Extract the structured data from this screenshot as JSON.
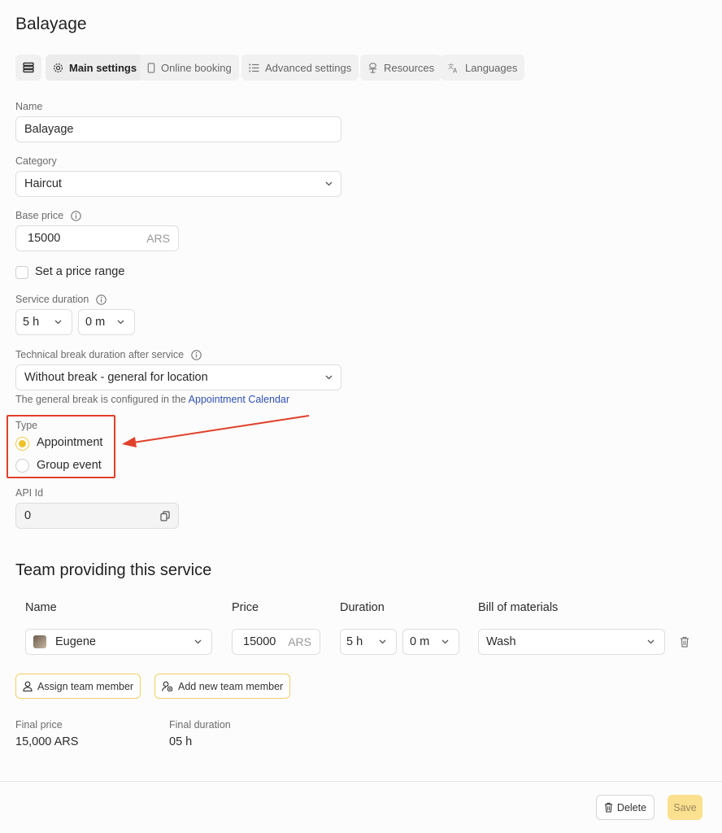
{
  "page_title": "Balayage",
  "tabs": [
    {
      "label": "Main settings",
      "icon": "gear-icon"
    },
    {
      "label": "Online booking",
      "icon": "phone-icon"
    },
    {
      "label": "Advanced settings",
      "icon": "list-icon"
    },
    {
      "label": "Resources",
      "icon": "chair-icon"
    },
    {
      "label": "Languages",
      "icon": "translate-icon"
    }
  ],
  "form": {
    "name_label": "Name",
    "name_value": "Balayage",
    "category_label": "Category",
    "category_value": "Haircut",
    "base_price_label": "Base price",
    "base_price_value": "15000",
    "base_price_currency": "ARS",
    "price_range_label": "Set a price range",
    "service_duration_label": "Service duration",
    "duration_hours": "5 h",
    "duration_minutes": "0 m",
    "break_label": "Technical break duration after service",
    "break_value": "Without break - general for location",
    "break_note_prefix": "The general break is configured in the",
    "break_note_link": "Appointment Calendar",
    "type_label": "Type",
    "type_options": [
      "Appointment",
      "Group event"
    ],
    "type_selected": "Appointment",
    "api_id_label": "API Id",
    "api_id_value": "0"
  },
  "team": {
    "section_title": "Team providing this service",
    "columns": [
      "Name",
      "Price",
      "Duration",
      "Bill of materials"
    ],
    "row": {
      "member": "Eugene",
      "price": "15000",
      "currency": "ARS",
      "hours": "5 h",
      "minutes": "0 m",
      "bill": "Wash"
    },
    "assign_button": "Assign team member",
    "add_button": "Add new team member"
  },
  "summary": {
    "final_price_label": "Final price",
    "final_price_value": "15,000 ARS",
    "final_duration_label": "Final duration",
    "final_duration_value": "05 h"
  },
  "footer": {
    "delete_label": "Delete",
    "save_label": "Save"
  },
  "colors": {
    "accent": "#f0c229",
    "annotation_red": "#e0402a",
    "link": "#2f4fb3"
  }
}
